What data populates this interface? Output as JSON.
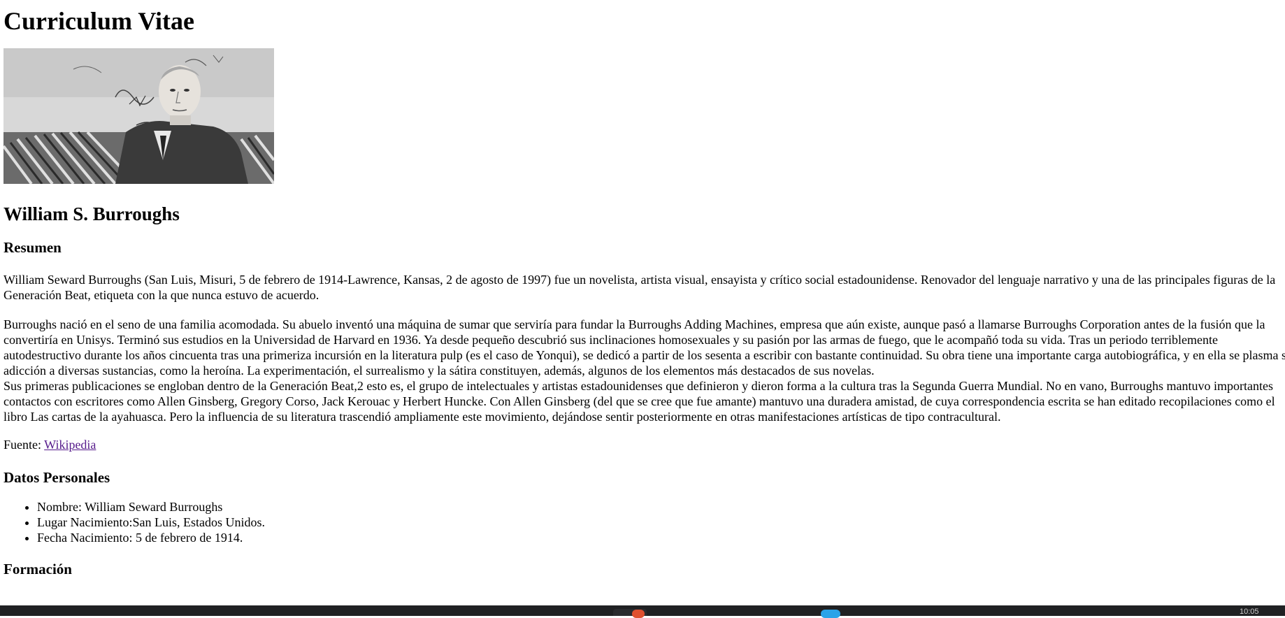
{
  "document": {
    "title": "Curriculum Vitae",
    "photo_alt": "Fotografía en blanco y negro de William S. Burroughs",
    "name": "William S. Burroughs",
    "summary_heading": "Resumen",
    "summary_p1": "William Seward Burroughs (San Luis, Misuri, 5 de febrero de 1914-Lawrence, Kansas, 2 de agosto de 1997) fue un novelista, artista visual, ensayista y crítico social estadounidense. Renovador del lenguaje narrativo y una de las principales figuras de la Generación Beat, etiqueta con la que nunca estuvo de acuerdo.",
    "summary_p2a": "Burroughs nació en el seno de una familia acomodada. Su abuelo inventó una máquina de sumar que serviría para fundar la Burroughs Adding Machines, empresa que aún existe, aunque pasó a llamarse Burroughs Corporation antes de la fusión que la convertiría en Unisys. Terminó sus estudios en la Universidad de Harvard en 1936. Ya desde pequeño descubrió sus inclinaciones homosexuales y su pasión por las armas de fuego, que le acompañó toda su vida. Tras un periodo terriblemente autodestructivo durante los años cincuenta tras una primeriza incursión en la literatura pulp (es el caso de Yonqui), se dedicó a partir de los sesenta a escribir con bastante continuidad. Su obra tiene una importante carga autobiográfica, y en ella se plasma su adicción a diversas sustancias, como la heroína. La experimentación, el surrealismo y la sátira constituyen, además, algunos de los elementos más destacados de sus novelas.",
    "summary_p2b": "Sus primeras publicaciones se engloban dentro de la Generación Beat,2 esto es, el grupo de intelectuales y artistas estadounidenses que definieron y dieron forma a la cultura tras la Segunda Guerra Mundial. No en vano, Burroughs mantuvo importantes contactos con escritores como Allen Ginsberg, Gregory Corso, Jack Kerouac y Herbert Huncke. Con Allen Ginsberg (del que se cree que fue amante) mantuvo una duradera amistad, de cuya correspondencia escrita se han editado recopilaciones como el libro Las cartas de la ayahuasca. Pero la influencia de su literatura trascendió ampliamente este movimiento, dejándose sentir posteriormente en otras manifestaciones artísticas de tipo contracultural.",
    "source_label": "Fuente: ",
    "source_link": "Wikipedia",
    "personal_heading": "Datos Personales",
    "personal_items": [
      "Nombre: William Seward Burroughs",
      "Lugar Nacimiento:San Luis, Estados Unidos.",
      "Fecha Nacimiento: 5 de febrero de 1914."
    ],
    "education_heading": "Formación"
  },
  "taskbar": {
    "clock": "10:05"
  }
}
